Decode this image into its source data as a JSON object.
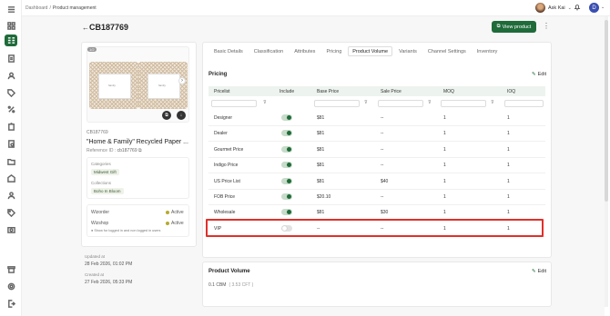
{
  "breadcrumb": {
    "root": "Dashboard",
    "separator": "/",
    "current": "Product management"
  },
  "user": {
    "name": "Ask Kai"
  },
  "org_avatar": "D",
  "header": {
    "title": "CB187769",
    "view_button": "View product"
  },
  "product": {
    "image_counter": "1/2",
    "frame_text": "family",
    "sku": "CB187769",
    "name": "\"Home & Family\" Recycled Paper ...",
    "reference_label": "Reference ID :",
    "reference_value": "cb187769"
  },
  "categories": {
    "label": "Categories",
    "values": [
      "Midwest Gift"
    ]
  },
  "collections": {
    "label": "Collections",
    "values": [
      "Boho In Bloom"
    ]
  },
  "availability": [
    {
      "name": "Wizorder",
      "status": "Active"
    },
    {
      "name": "Wizshop",
      "status": "Active"
    }
  ],
  "availability_note": "Show for logged in and non logged in users",
  "meta": {
    "updated_label": "Updated at",
    "updated_value": "28 Feb 2026, 01:02 PM",
    "created_label": "Created at",
    "created_value": "27 Feb 2026, 05:33 PM"
  },
  "tabs": [
    "Basic Details",
    "Classification",
    "Attributes",
    "Pricing",
    "Product Volume",
    "Variants",
    "Channel Settings",
    "Inventory"
  ],
  "active_tab": "Product Volume",
  "pricing": {
    "title": "Pricing",
    "edit_label": "Edit",
    "columns": [
      "Pricelist",
      "Include",
      "Base Price",
      "Sale Price",
      "MOQ",
      "IOQ"
    ],
    "rows": [
      {
        "pricelist": "Designer",
        "include": true,
        "base": "$81",
        "sale": "--",
        "moq": "1",
        "ioq": "1"
      },
      {
        "pricelist": "Dealer",
        "include": true,
        "base": "$81",
        "sale": "--",
        "moq": "1",
        "ioq": "1"
      },
      {
        "pricelist": "Gourmet Price",
        "include": true,
        "base": "$81",
        "sale": "--",
        "moq": "1",
        "ioq": "1"
      },
      {
        "pricelist": "Indigo Price",
        "include": true,
        "base": "$81",
        "sale": "--",
        "moq": "1",
        "ioq": "1"
      },
      {
        "pricelist": "US Price List",
        "include": true,
        "base": "$81",
        "sale": "$40",
        "moq": "1",
        "ioq": "1"
      },
      {
        "pricelist": "FOB Price",
        "include": true,
        "base": "$20.10",
        "sale": "--",
        "moq": "1",
        "ioq": "1"
      },
      {
        "pricelist": "Wholesale",
        "include": true,
        "base": "$81",
        "sale": "$30",
        "moq": "1",
        "ioq": "1"
      },
      {
        "pricelist": "VIP",
        "include": false,
        "base": "--",
        "sale": "--",
        "moq": "1",
        "ioq": "1"
      }
    ]
  },
  "product_volume": {
    "title": "Product Volume",
    "edit_label": "Edit",
    "value": "0.1 CBM",
    "sub": "( 3.53 CFT )"
  },
  "colors": {
    "brand": "#1f6b3a",
    "highlight": "#e0302a",
    "table_header": "#edf3ee"
  }
}
